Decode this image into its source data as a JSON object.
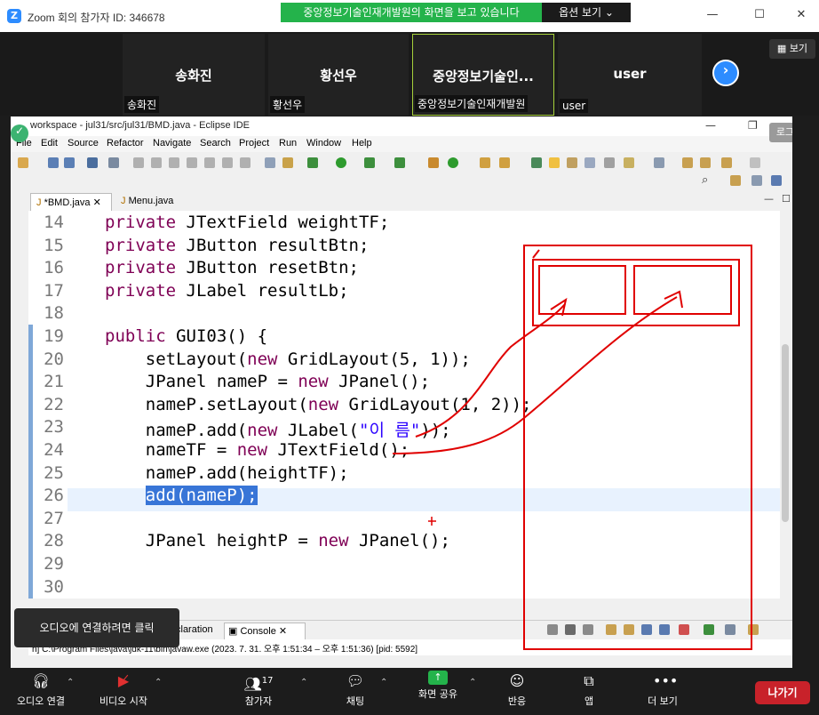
{
  "window": {
    "title": "Zoom 회의 참가자 ID: 346678",
    "share_banner": "중앙정보기술인재개발원의 화면을 보고 있습니다",
    "view_options": "옵션 보기"
  },
  "participants": [
    {
      "display": "송화진",
      "label": "송화진"
    },
    {
      "display": "황선우",
      "label": "황선우"
    },
    {
      "display": "중앙정보기술인...",
      "label": "중앙정보기술인재개발원"
    },
    {
      "display": "user",
      "label": "user"
    }
  ],
  "view_button": "보기",
  "eclipse": {
    "title": "workspace - jul31/src/jul31/BMD.java - Eclipse IDE",
    "menu": [
      "File",
      "Edit",
      "Source",
      "Refactor",
      "Navigate",
      "Search",
      "Project",
      "Run",
      "Window",
      "Help"
    ],
    "tabs": [
      "*BMD.java",
      "Menu.java"
    ],
    "login_button": "로그인",
    "console_tabs": [
      "claration",
      "Console"
    ],
    "console_line": "n] C:\\Program Files\\java\\jdk-11\\bin\\javaw.exe  (2023. 7. 31. 오후 1:51:34 – 오후 1:51:36) [pid: 5592]"
  },
  "code_lines": [
    {
      "n": "14",
      "t": "private JTextField weightTF;"
    },
    {
      "n": "15",
      "t": "private JButton resultBtn;"
    },
    {
      "n": "16",
      "t": "private JButton resetBtn;"
    },
    {
      "n": "17",
      "t": "private JLabel resultLb;"
    },
    {
      "n": "18",
      "t": ""
    },
    {
      "n": "19",
      "t": "public GUI03() {"
    },
    {
      "n": "20",
      "t": "    setLayout(new GridLayout(5, 1));"
    },
    {
      "n": "21",
      "t": "    JPanel nameP = new JPanel();"
    },
    {
      "n": "22",
      "t": "    nameP.setLayout(new GridLayout(1, 2));"
    },
    {
      "n": "23",
      "t": "    nameP.add(new JLabel(\"이 름\"));"
    },
    {
      "n": "24",
      "t": "    nameTF = new JTextField();"
    },
    {
      "n": "25",
      "t": "    nameP.add(heightTF);"
    },
    {
      "n": "26",
      "t": "    add(nameP);"
    },
    {
      "n": "27",
      "t": ""
    },
    {
      "n": "28",
      "t": "    JPanel heightP = new JPanel();"
    },
    {
      "n": "29",
      "t": ""
    },
    {
      "n": "30",
      "t": ""
    }
  ],
  "tooltip": "오디오에 연결하려면 클릭",
  "toolbar": {
    "audio": "오디오 연결",
    "video": "비디오 시작",
    "participants": "참가자",
    "participant_count": "17",
    "chat": "채팅",
    "share": "화면 공유",
    "reactions": "반응",
    "apps": "앱",
    "more": "더 보기",
    "leave": "나가기"
  },
  "colors": {
    "zoom_blue": "#2d8cff",
    "share_green": "#24b34b",
    "leave_red": "#c8222a",
    "annotation_red": "#e00000"
  }
}
